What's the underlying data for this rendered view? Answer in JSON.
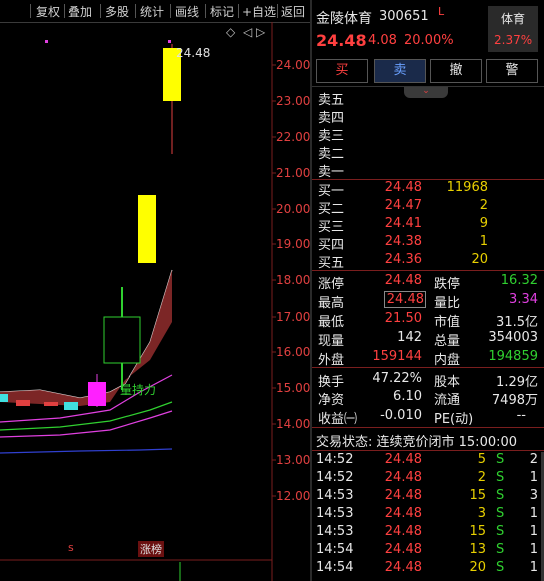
{
  "toolbar": {
    "items": [
      "复权",
      "叠加",
      "多股",
      "统计",
      "画线",
      "标记",
      "+自选",
      "返回"
    ]
  },
  "chart": {
    "y_ticks": [
      "24.00",
      "23.00",
      "22.00",
      "21.00",
      "20.00",
      "19.00",
      "18.00",
      "17.00",
      "16.00",
      "15.00",
      "14.00",
      "13.00",
      "12.00"
    ],
    "high_label": "24.48",
    "indicator_label": "量持力",
    "marker_s": "s",
    "limit_up_badge": "涨榜",
    "options_icon": "◇",
    "nav_icon": "◁ ▷"
  },
  "stock": {
    "name": "金陵体育",
    "code": "300651",
    "flag": "L",
    "price": "24.48",
    "change": "4.08",
    "change_pct": "20.00%",
    "sector_name": "体育",
    "sector_pct": "2.37%"
  },
  "trade_buttons": [
    "买",
    "卖",
    "撤",
    "警"
  ],
  "sell_levels": [
    {
      "label": "卖五",
      "price": "",
      "volume": ""
    },
    {
      "label": "卖四",
      "price": "",
      "volume": ""
    },
    {
      "label": "卖三",
      "price": "",
      "volume": ""
    },
    {
      "label": "卖二",
      "price": "",
      "volume": ""
    },
    {
      "label": "卖一",
      "price": "",
      "volume": ""
    }
  ],
  "buy_levels": [
    {
      "label": "买一",
      "price": "24.48",
      "volume": "11968"
    },
    {
      "label": "买二",
      "price": "24.47",
      "volume": "2"
    },
    {
      "label": "买三",
      "price": "24.41",
      "volume": "9"
    },
    {
      "label": "买四",
      "price": "24.38",
      "volume": "1"
    },
    {
      "label": "买五",
      "price": "24.36",
      "volume": "20"
    }
  ],
  "stats": {
    "limit_up_label": "涨停",
    "limit_up": "24.48",
    "limit_down_label": "跌停",
    "limit_down": "16.32",
    "high_label": "最高",
    "high": "24.48",
    "vol_ratio_label": "量比",
    "vol_ratio": "3.34",
    "low_label": "最低",
    "low": "21.50",
    "mktcap_label": "市值",
    "mktcap": "31.5亿",
    "current_vol_label": "现量",
    "current_vol": "142",
    "total_vol_label": "总量",
    "total_vol": "354003",
    "outer_label": "外盘",
    "outer": "159144",
    "inner_label": "内盘",
    "inner": "194859",
    "turnover_label": "换手",
    "turnover": "47.22%",
    "shares_label": "股本",
    "shares": "1.29亿",
    "nav_label": "净资",
    "nav": "6.10",
    "float_label": "流通",
    "float": "7498万",
    "eps_label": "收益㈠",
    "eps": "-0.010",
    "pe_label": "PE(动)",
    "pe": "--"
  },
  "trade_status": "交易状态: 连续竞价闭市 15:00:00",
  "ticks": [
    {
      "time": "14:52",
      "price": "24.48",
      "vol": "5",
      "side": "S",
      "count": "2"
    },
    {
      "time": "14:52",
      "price": "24.48",
      "vol": "2",
      "side": "S",
      "count": "1"
    },
    {
      "time": "14:53",
      "price": "24.48",
      "vol": "15",
      "side": "S",
      "count": "3"
    },
    {
      "time": "14:53",
      "price": "24.48",
      "vol": "3",
      "side": "S",
      "count": "1"
    },
    {
      "time": "14:53",
      "price": "24.48",
      "vol": "15",
      "side": "S",
      "count": "1"
    },
    {
      "time": "14:54",
      "price": "24.48",
      "vol": "13",
      "side": "S",
      "count": "1"
    },
    {
      "time": "14:54",
      "price": "24.48",
      "vol": "20",
      "side": "S",
      "count": "1"
    }
  ],
  "colors": {
    "up": "#ff4040",
    "down": "#30d030",
    "neutral": "#e8d000",
    "candle_limit": "#ffff00"
  }
}
